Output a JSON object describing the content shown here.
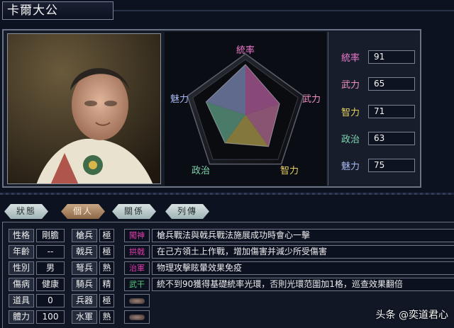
{
  "character": {
    "name": "卡爾大公"
  },
  "radar": {
    "labels": {
      "leadership": "統率",
      "war": "武力",
      "intelligence": "智力",
      "politics": "政治",
      "charisma": "魅力"
    },
    "max": 100
  },
  "stats": [
    {
      "label": "統率",
      "value": "91",
      "color": "#f07ccf"
    },
    {
      "label": "武力",
      "value": "65",
      "color": "#f090c2"
    },
    {
      "label": "智力",
      "value": "71",
      "color": "#e8d060"
    },
    {
      "label": "政治",
      "value": "63",
      "color": "#7fd6b0"
    },
    {
      "label": "魅力",
      "value": "75",
      "color": "#a8b8f2"
    }
  ],
  "tabs": [
    {
      "label": "狀態",
      "active": false
    },
    {
      "label": "個人",
      "active": true
    },
    {
      "label": "關係",
      "active": false
    },
    {
      "label": "列傳",
      "active": false
    }
  ],
  "personal": [
    {
      "label": "性格",
      "value": "剛膽"
    },
    {
      "label": "年齡",
      "value": "--"
    },
    {
      "label": "性別",
      "value": "男"
    },
    {
      "label": "傷病",
      "value": "健康"
    },
    {
      "label": "道具",
      "value": "0"
    },
    {
      "label": "體力",
      "value": "100"
    }
  ],
  "aptitudes": [
    {
      "label": "槍兵",
      "value": "極"
    },
    {
      "label": "戟兵",
      "value": "極"
    },
    {
      "label": "弩兵",
      "value": "熟"
    },
    {
      "label": "騎兵",
      "value": "精"
    },
    {
      "label": "兵器",
      "value": "極"
    },
    {
      "label": "水軍",
      "value": "熟"
    }
  ],
  "skills": [
    {
      "name": "闖神",
      "color": "#e03aa8",
      "desc": "槍兵戰法與戟兵戰法施展成功時會心一擊"
    },
    {
      "name": "拱戟",
      "color": "#e03aa8",
      "desc": "在己方領土上作戰，增加傷害并減少所受傷害"
    },
    {
      "name": "治軍",
      "color": "#e03aa8",
      "desc": "物理攻擊眩暈效果免疫"
    },
    {
      "name": "武干",
      "color": "#58c878",
      "desc": "統不到90獲得基礎統率光環，否則光環范圍加1格，巡查效果翻倍"
    }
  ],
  "watermark": "头条 @奕道君心"
}
